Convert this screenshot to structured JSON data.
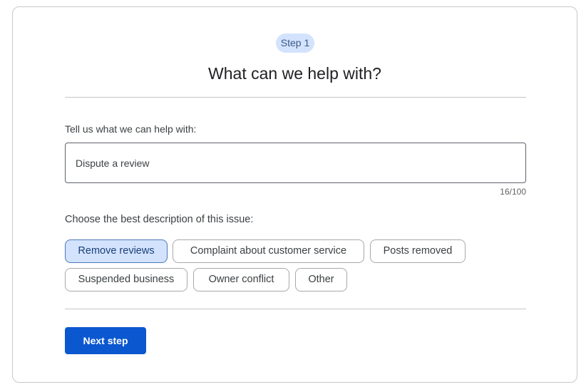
{
  "step": {
    "badge_label": "Step 1",
    "title": "What can we help with?"
  },
  "help_field": {
    "label": "Tell us what we can help with:",
    "value": "Dispute a review",
    "counter": "16/100"
  },
  "issue": {
    "label": "Choose the best description of this issue:",
    "options": [
      {
        "label": "Remove reviews",
        "selected": true
      },
      {
        "label": "Complaint about customer service",
        "selected": false
      },
      {
        "label": "Posts removed",
        "selected": false
      },
      {
        "label": "Suspended business",
        "selected": false
      },
      {
        "label": "Owner conflict",
        "selected": false
      },
      {
        "label": "Other",
        "selected": false
      }
    ]
  },
  "actions": {
    "next_label": "Next step"
  },
  "colors": {
    "primary": "#0b57d0",
    "selected_chip_bg": "#d3e3fd",
    "badge_bg": "#d3e3fd"
  }
}
